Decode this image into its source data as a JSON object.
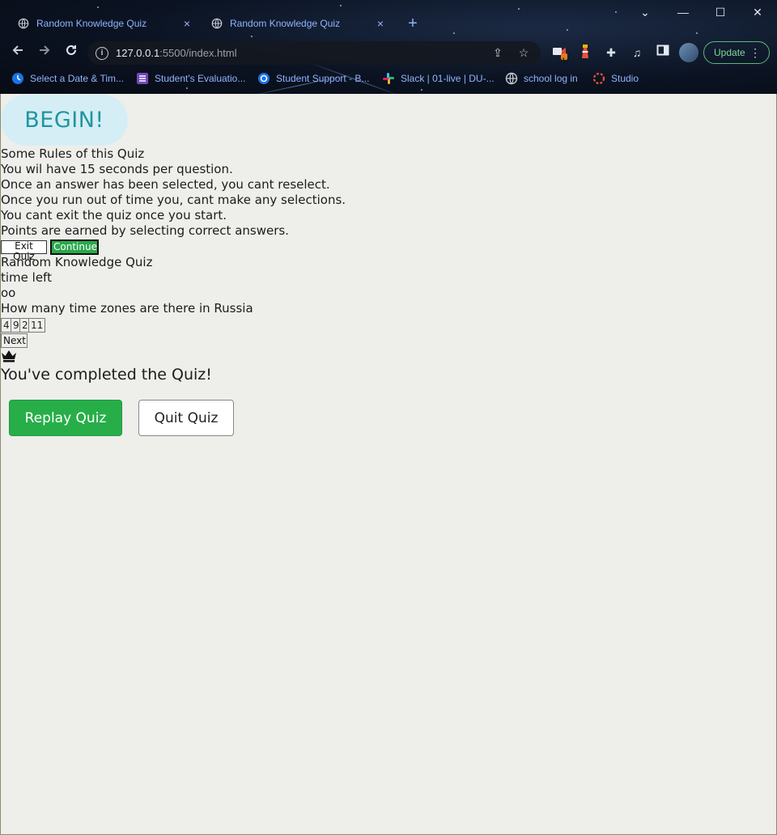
{
  "browser": {
    "tabs": [
      {
        "title": "Random Knowledge Quiz",
        "close": "×"
      },
      {
        "title": "Random Knowledge Quiz",
        "close": "×"
      }
    ],
    "new_tab": "+",
    "window_controls": {
      "dropdown": "⌄",
      "minimize": "—",
      "maximize": "☐",
      "close": "✕"
    },
    "url_host": "127.0.0.1",
    "url_path": ":5500/index.html",
    "update_label": "Update",
    "extension_badge": "1",
    "bookmarks": [
      {
        "label": "Select a Date & Tim...",
        "icon": "clock-icon"
      },
      {
        "label": "Student's Evaluatio...",
        "icon": "form-icon"
      },
      {
        "label": "Student Support - B...",
        "icon": "support-icon"
      },
      {
        "label": "Slack | 01-live | DU-...",
        "icon": "slack-icon"
      },
      {
        "label": "school log in",
        "icon": "globe-icon"
      },
      {
        "label": "Studio",
        "icon": "studio-icon"
      }
    ]
  },
  "quiz": {
    "begin_label": "BEGIN!",
    "rules_title": "Some Rules of this Quiz",
    "rules": [
      "You wil have 15 seconds per question.",
      "Once an answer has been selected, you cant reselect.",
      "Once you run out of time you, cant make any selections.",
      "You cant exit the quiz once you start.",
      "Points are earned by selecting correct answers."
    ],
    "exit_label": "Exit Quiz",
    "continue_label": "Continue",
    "quiz_title": "Random Knowledge Quiz",
    "time_label": "time left",
    "time_value": "oo",
    "question": "How many time zones are there in Russia",
    "options": [
      "4",
      "9",
      "2",
      "11"
    ],
    "next_label": "Next",
    "completed_text": "You've completed the Quiz!",
    "replay_label": "Replay Quiz",
    "quit_label": "Quit Quiz"
  },
  "colors": {
    "page_bg": "#eeeeea",
    "begin_bg": "#d5eef6",
    "begin_text": "#22959f",
    "continue_bg": "#2aa84a",
    "replay_bg": "#27ae49",
    "link_blue": "#8fb4ff"
  }
}
